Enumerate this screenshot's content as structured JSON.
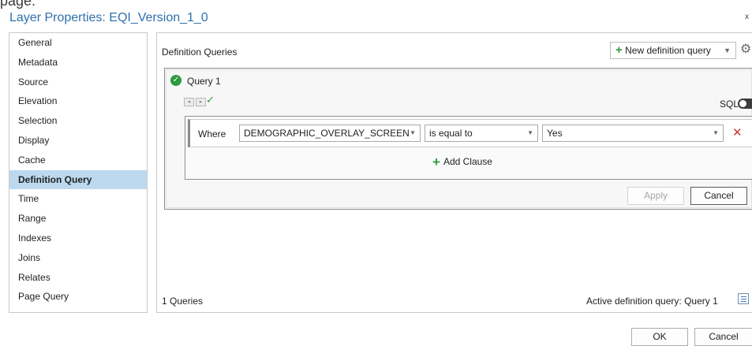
{
  "dialog": {
    "title": "Layer Properties: EQI_Version_1_0",
    "close_glyph": "x",
    "top_cut_text": "page."
  },
  "nav": {
    "items": [
      {
        "label": "General",
        "active": false
      },
      {
        "label": "Metadata",
        "active": false
      },
      {
        "label": "Source",
        "active": false
      },
      {
        "label": "Elevation",
        "active": false
      },
      {
        "label": "Selection",
        "active": false
      },
      {
        "label": "Display",
        "active": false
      },
      {
        "label": "Cache",
        "active": false
      },
      {
        "label": "Definition Query",
        "active": true
      },
      {
        "label": "Time",
        "active": false
      },
      {
        "label": "Range",
        "active": false
      },
      {
        "label": "Indexes",
        "active": false
      },
      {
        "label": "Joins",
        "active": false
      },
      {
        "label": "Relates",
        "active": false
      },
      {
        "label": "Page Query",
        "active": false
      }
    ]
  },
  "main": {
    "section_label": "Definition Queries",
    "new_query_label": "New definition query",
    "query": {
      "name": "Query 1",
      "sql_label": "SQL",
      "sql_enabled": false,
      "clause": {
        "where_label": "Where",
        "field": "DEMOGRAPHIC_OVERLAY_SCREEN",
        "operator": "is equal to",
        "value": "Yes"
      },
      "add_clause_label": "Add Clause",
      "apply_label": "Apply",
      "cancel_label": "Cancel"
    },
    "footer": {
      "query_count": "1 Queries",
      "active_query": "Active definition query: Query 1"
    }
  },
  "buttons": {
    "ok": "OK",
    "cancel": "Cancel"
  },
  "colors": {
    "accent": "#2f6fad",
    "active_nav": "#bcd9ef",
    "success": "#2e9a3e",
    "danger": "#d13438"
  }
}
